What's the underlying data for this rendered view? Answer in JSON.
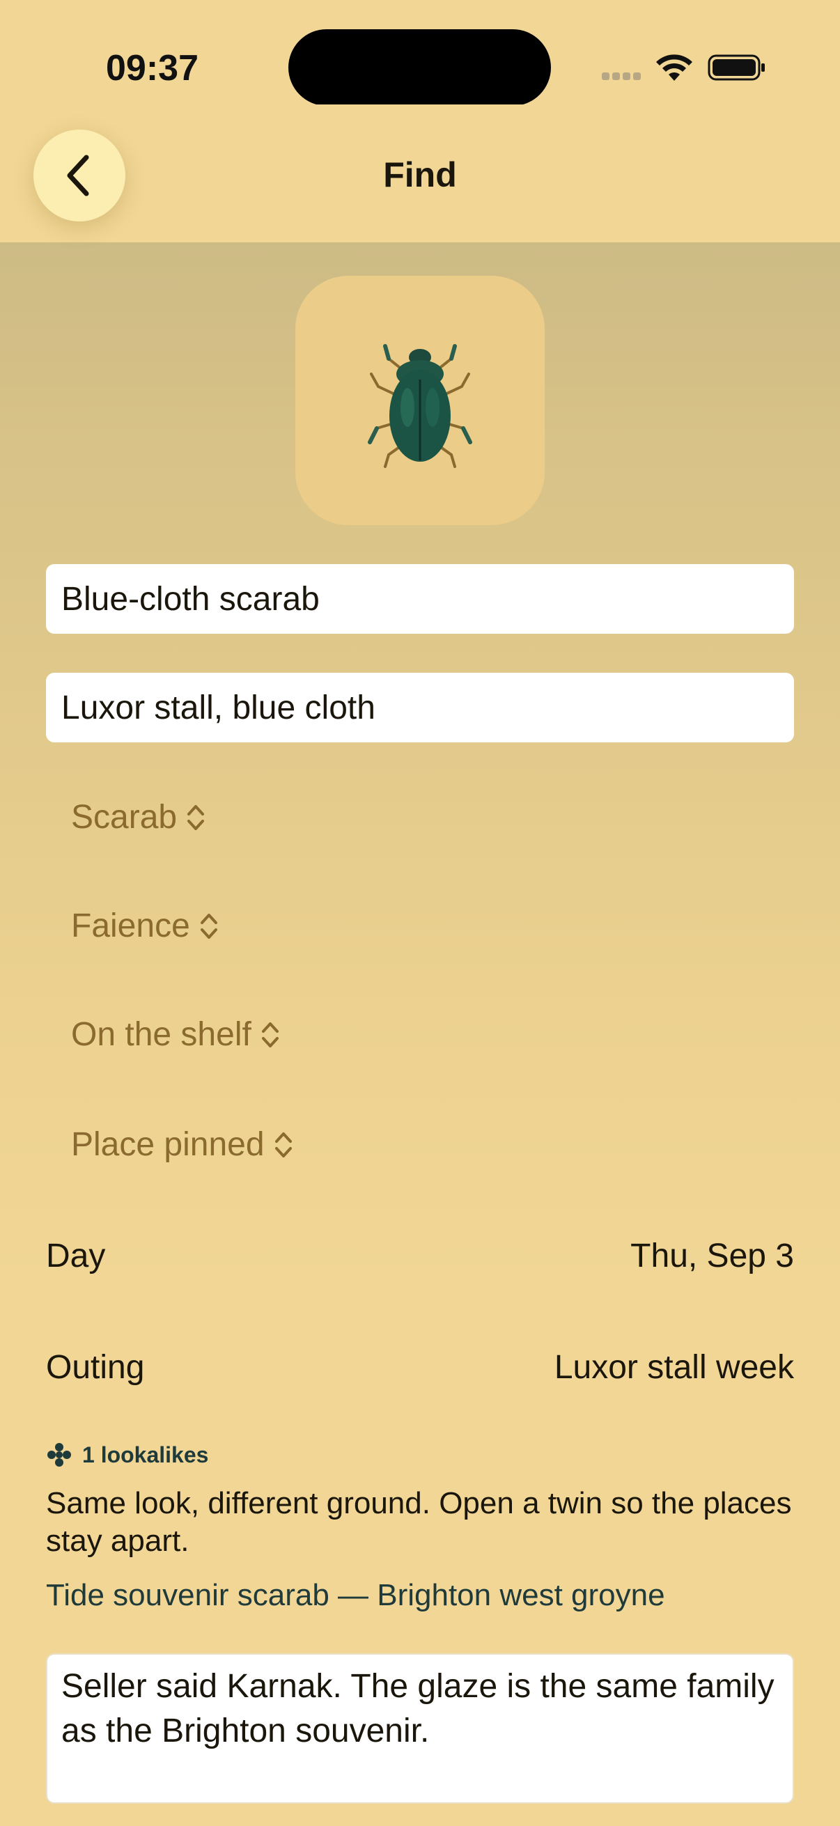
{
  "status_bar": {
    "time": "09:37"
  },
  "nav": {
    "title": "Find",
    "back_icon": "chevron-left-icon"
  },
  "photo": {
    "alt": "beetle-image"
  },
  "fields": {
    "name": "Blue-cloth scarab",
    "place": "Luxor stall, blue cloth"
  },
  "pickers": [
    {
      "label": "Scarab"
    },
    {
      "label": "Faience"
    },
    {
      "label": "On the shelf"
    },
    {
      "label": "Place pinned"
    }
  ],
  "rows": {
    "day": {
      "label": "Day",
      "value": "Thu, Sep 3"
    },
    "outing": {
      "label": "Outing",
      "value": "Luxor stall week"
    }
  },
  "lookalikes": {
    "count_label": "1 lookalikes",
    "description": "Same look, different ground. Open a twin so the places stay apart.",
    "link": "Tide souvenir scarab — Brighton west groyne"
  },
  "notes": {
    "text": "Seller said Karnak. The glaze is the same family as the Brighton souvenir."
  },
  "colors": {
    "background": "#f1d695",
    "picker_text": "#8a6a2e",
    "accent_teal": "#1f3a3a"
  }
}
